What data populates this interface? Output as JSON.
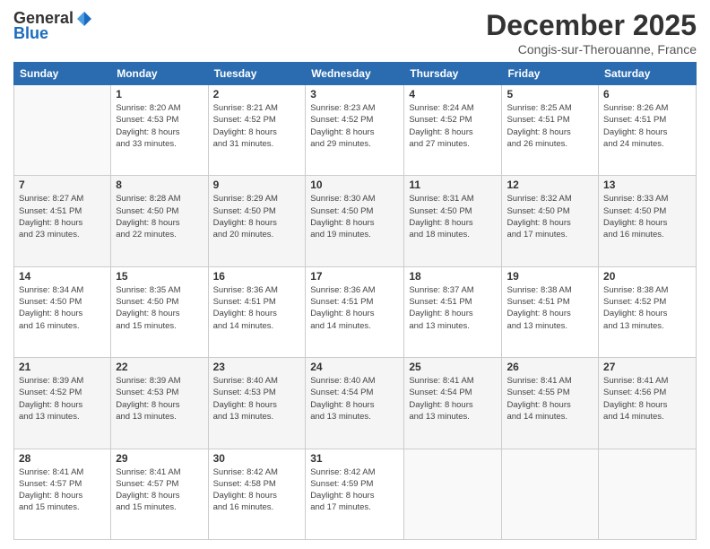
{
  "logo": {
    "general": "General",
    "blue": "Blue"
  },
  "title": "December 2025",
  "subtitle": "Congis-sur-Therouanne, France",
  "headers": [
    "Sunday",
    "Monday",
    "Tuesday",
    "Wednesday",
    "Thursday",
    "Friday",
    "Saturday"
  ],
  "weeks": [
    [
      {
        "day": "",
        "info": ""
      },
      {
        "day": "1",
        "info": "Sunrise: 8:20 AM\nSunset: 4:53 PM\nDaylight: 8 hours\nand 33 minutes."
      },
      {
        "day": "2",
        "info": "Sunrise: 8:21 AM\nSunset: 4:52 PM\nDaylight: 8 hours\nand 31 minutes."
      },
      {
        "day": "3",
        "info": "Sunrise: 8:23 AM\nSunset: 4:52 PM\nDaylight: 8 hours\nand 29 minutes."
      },
      {
        "day": "4",
        "info": "Sunrise: 8:24 AM\nSunset: 4:52 PM\nDaylight: 8 hours\nand 27 minutes."
      },
      {
        "day": "5",
        "info": "Sunrise: 8:25 AM\nSunset: 4:51 PM\nDaylight: 8 hours\nand 26 minutes."
      },
      {
        "day": "6",
        "info": "Sunrise: 8:26 AM\nSunset: 4:51 PM\nDaylight: 8 hours\nand 24 minutes."
      }
    ],
    [
      {
        "day": "7",
        "info": "Sunrise: 8:27 AM\nSunset: 4:51 PM\nDaylight: 8 hours\nand 23 minutes."
      },
      {
        "day": "8",
        "info": "Sunrise: 8:28 AM\nSunset: 4:50 PM\nDaylight: 8 hours\nand 22 minutes."
      },
      {
        "day": "9",
        "info": "Sunrise: 8:29 AM\nSunset: 4:50 PM\nDaylight: 8 hours\nand 20 minutes."
      },
      {
        "day": "10",
        "info": "Sunrise: 8:30 AM\nSunset: 4:50 PM\nDaylight: 8 hours\nand 19 minutes."
      },
      {
        "day": "11",
        "info": "Sunrise: 8:31 AM\nSunset: 4:50 PM\nDaylight: 8 hours\nand 18 minutes."
      },
      {
        "day": "12",
        "info": "Sunrise: 8:32 AM\nSunset: 4:50 PM\nDaylight: 8 hours\nand 17 minutes."
      },
      {
        "day": "13",
        "info": "Sunrise: 8:33 AM\nSunset: 4:50 PM\nDaylight: 8 hours\nand 16 minutes."
      }
    ],
    [
      {
        "day": "14",
        "info": "Sunrise: 8:34 AM\nSunset: 4:50 PM\nDaylight: 8 hours\nand 16 minutes."
      },
      {
        "day": "15",
        "info": "Sunrise: 8:35 AM\nSunset: 4:50 PM\nDaylight: 8 hours\nand 15 minutes."
      },
      {
        "day": "16",
        "info": "Sunrise: 8:36 AM\nSunset: 4:51 PM\nDaylight: 8 hours\nand 14 minutes."
      },
      {
        "day": "17",
        "info": "Sunrise: 8:36 AM\nSunset: 4:51 PM\nDaylight: 8 hours\nand 14 minutes."
      },
      {
        "day": "18",
        "info": "Sunrise: 8:37 AM\nSunset: 4:51 PM\nDaylight: 8 hours\nand 13 minutes."
      },
      {
        "day": "19",
        "info": "Sunrise: 8:38 AM\nSunset: 4:51 PM\nDaylight: 8 hours\nand 13 minutes."
      },
      {
        "day": "20",
        "info": "Sunrise: 8:38 AM\nSunset: 4:52 PM\nDaylight: 8 hours\nand 13 minutes."
      }
    ],
    [
      {
        "day": "21",
        "info": "Sunrise: 8:39 AM\nSunset: 4:52 PM\nDaylight: 8 hours\nand 13 minutes."
      },
      {
        "day": "22",
        "info": "Sunrise: 8:39 AM\nSunset: 4:53 PM\nDaylight: 8 hours\nand 13 minutes."
      },
      {
        "day": "23",
        "info": "Sunrise: 8:40 AM\nSunset: 4:53 PM\nDaylight: 8 hours\nand 13 minutes."
      },
      {
        "day": "24",
        "info": "Sunrise: 8:40 AM\nSunset: 4:54 PM\nDaylight: 8 hours\nand 13 minutes."
      },
      {
        "day": "25",
        "info": "Sunrise: 8:41 AM\nSunset: 4:54 PM\nDaylight: 8 hours\nand 13 minutes."
      },
      {
        "day": "26",
        "info": "Sunrise: 8:41 AM\nSunset: 4:55 PM\nDaylight: 8 hours\nand 14 minutes."
      },
      {
        "day": "27",
        "info": "Sunrise: 8:41 AM\nSunset: 4:56 PM\nDaylight: 8 hours\nand 14 minutes."
      }
    ],
    [
      {
        "day": "28",
        "info": "Sunrise: 8:41 AM\nSunset: 4:57 PM\nDaylight: 8 hours\nand 15 minutes."
      },
      {
        "day": "29",
        "info": "Sunrise: 8:41 AM\nSunset: 4:57 PM\nDaylight: 8 hours\nand 15 minutes."
      },
      {
        "day": "30",
        "info": "Sunrise: 8:42 AM\nSunset: 4:58 PM\nDaylight: 8 hours\nand 16 minutes."
      },
      {
        "day": "31",
        "info": "Sunrise: 8:42 AM\nSunset: 4:59 PM\nDaylight: 8 hours\nand 17 minutes."
      },
      {
        "day": "",
        "info": ""
      },
      {
        "day": "",
        "info": ""
      },
      {
        "day": "",
        "info": ""
      }
    ]
  ]
}
